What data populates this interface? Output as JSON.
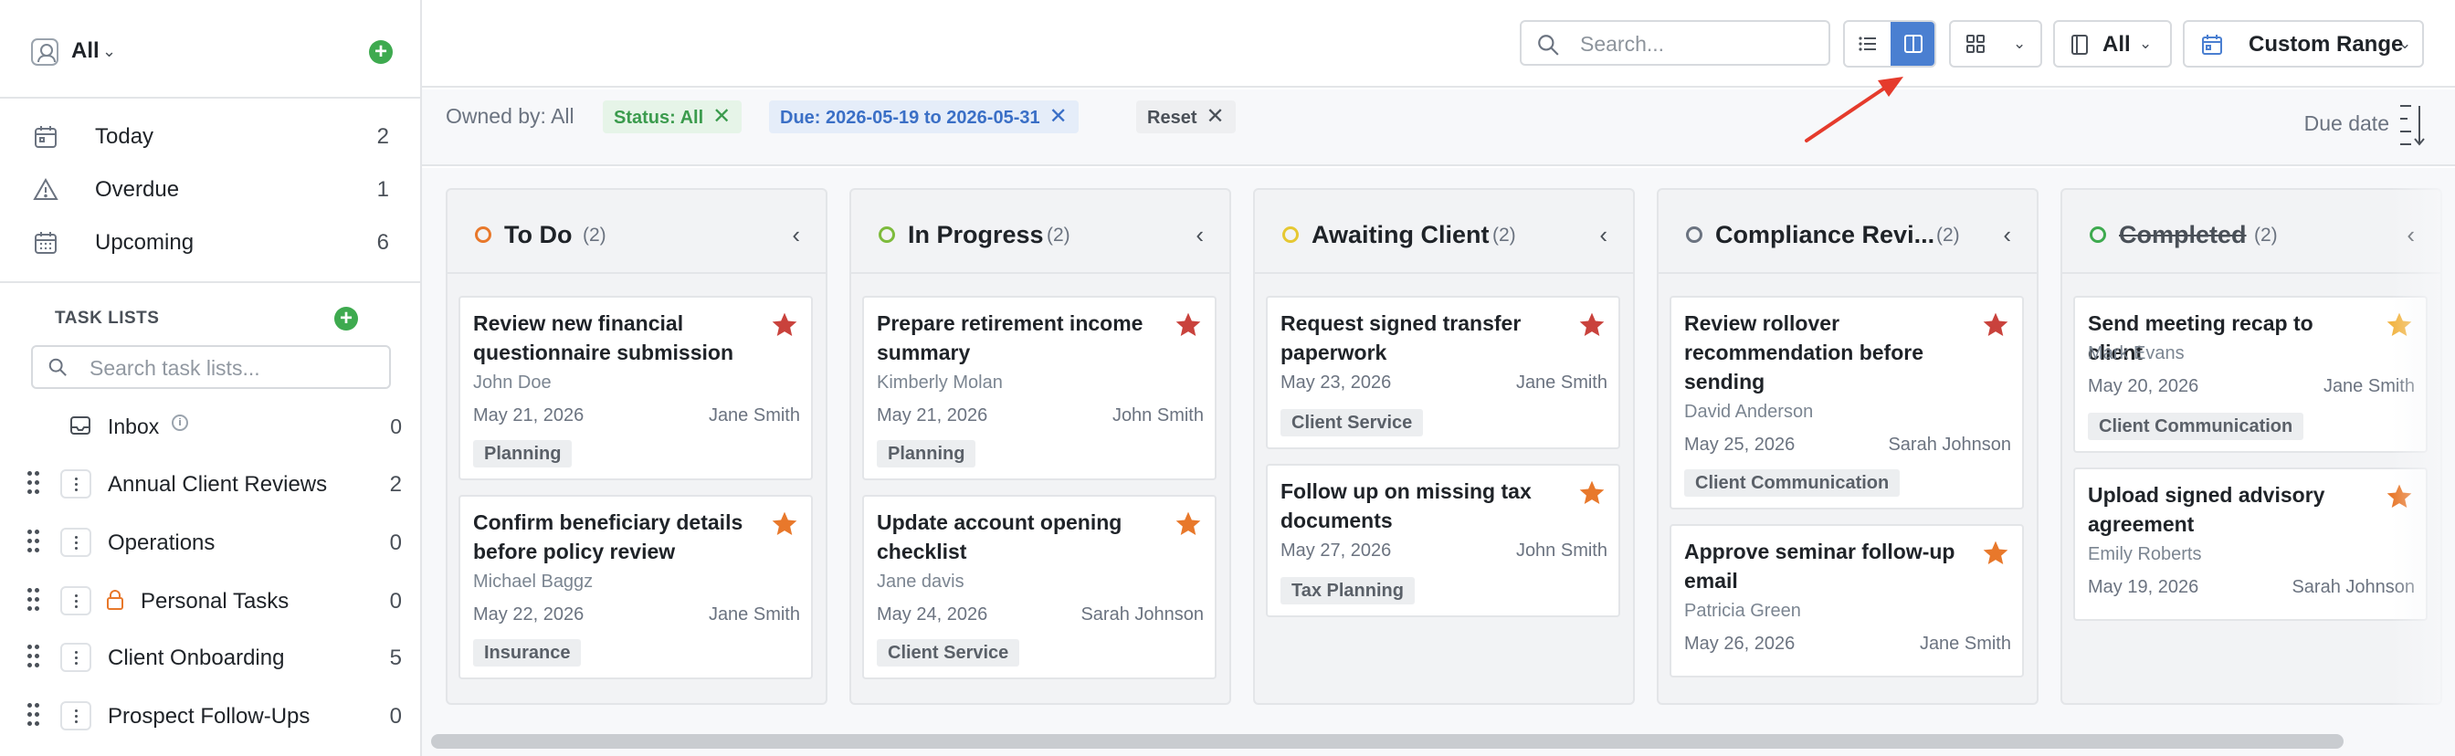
{
  "colors": {
    "accent_blue": "#4a7fd1",
    "success_green": "#3eaa4f",
    "star_red": "#c9423c",
    "star_orange": "#e8782b",
    "star_yellow": "#f2b442",
    "annotation_red": "#e53b2c"
  },
  "sidebar": {
    "workspace_label": "All",
    "nav": [
      {
        "label": "Today",
        "count": "2",
        "icon": "calendar-icon"
      },
      {
        "label": "Overdue",
        "count": "1",
        "icon": "warning-triangle-icon"
      },
      {
        "label": "Upcoming",
        "count": "6",
        "icon": "calendar-grid-icon"
      }
    ],
    "task_lists_header": "TASK LISTS",
    "task_list_search_placeholder": "Search task lists...",
    "inbox": {
      "label": "Inbox",
      "count": "0"
    },
    "lists": [
      {
        "label": "Annual Client Reviews",
        "count": "2",
        "locked": false
      },
      {
        "label": "Operations",
        "count": "0",
        "locked": false
      },
      {
        "label": "Personal Tasks",
        "count": "0",
        "locked": true
      },
      {
        "label": "Client Onboarding",
        "count": "5",
        "locked": false
      },
      {
        "label": "Prospect Follow-Ups",
        "count": "0",
        "locked": false
      }
    ]
  },
  "topbar": {
    "search_placeholder": "Search...",
    "owner_filter_label": "All",
    "date_range_label": "Custom Range"
  },
  "filters": {
    "owned_by": "Owned by: All",
    "status_chip": "Status: All",
    "due_chip": "Due: 2026-05-19 to 2026-05-31",
    "reset_chip": "Reset",
    "sort_label": "Due date"
  },
  "columns": [
    {
      "title": "To Do",
      "count": "(2)",
      "dot_color": "#e8782b",
      "cards": [
        {
          "title": "Review new financial questionnaire submission",
          "owner": "John Doe",
          "date": "May 21, 2026",
          "assignee": "Jane Smith",
          "tag": "Planning",
          "star": "#c9423c"
        },
        {
          "title": "Confirm beneficiary details before policy review",
          "owner": "Michael Baggz",
          "date": "May 22, 2026",
          "assignee": "Jane Smith",
          "tag": "Insurance",
          "star": "#e8782b"
        }
      ]
    },
    {
      "title": "In Progress",
      "count": "(2)",
      "dot_color": "#7dbb3c",
      "cards": [
        {
          "title": "Prepare retirement income summary",
          "owner": "Kimberly Molan",
          "date": "May 21, 2026",
          "assignee": "John Smith",
          "tag": "Planning",
          "star": "#c9423c"
        },
        {
          "title": "Update account opening checklist",
          "owner": "Jane davis",
          "date": "May 24, 2026",
          "assignee": "Sarah Johnson",
          "tag": "Client Service",
          "star": "#e8782b"
        }
      ]
    },
    {
      "title": "Awaiting Client",
      "count": "(2)",
      "dot_color": "#e6c832",
      "cards": [
        {
          "title": "Request signed transfer paperwork",
          "owner": "",
          "date": "May 23, 2026",
          "assignee": "Jane Smith",
          "tag": "Client Service",
          "star": "#c9423c"
        },
        {
          "title": "Follow up on missing tax documents",
          "owner": "",
          "date": "May 27, 2026",
          "assignee": "John Smith",
          "tag": "Tax Planning",
          "star": "#e8782b"
        }
      ]
    },
    {
      "title": "Compliance Revi...",
      "count": "(2)",
      "dot_color": "#6b7380",
      "cards": [
        {
          "title": "Review rollover recommendation before sending",
          "owner": "David Anderson",
          "date": "May 25, 2026",
          "assignee": "Sarah Johnson",
          "tag": "Client Communication",
          "star": "#c9423c"
        },
        {
          "title": "Approve seminar follow-up email",
          "owner": "Patricia Green",
          "date": "May 26, 2026",
          "assignee": "Jane Smith",
          "tag": "",
          "star": "#e8782b"
        }
      ]
    },
    {
      "title": "Completed",
      "count": "(2)",
      "dot_color": "#3eaa4f",
      "cards": [
        {
          "title": "Send meeting recap to client",
          "owner": "Mark Evans",
          "date": "May 20, 2026",
          "assignee": "Jane Smith",
          "tag": "Client Communication",
          "star": "#f2b442"
        },
        {
          "title": "Upload signed advisory agreement",
          "owner": "Emily Roberts",
          "date": "May 19, 2026",
          "assignee": "Sarah Johnson",
          "tag": "",
          "star": "#e8782b"
        }
      ]
    }
  ]
}
